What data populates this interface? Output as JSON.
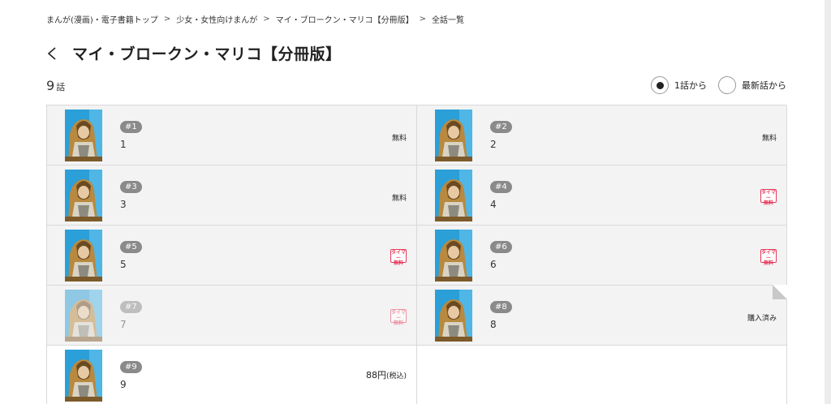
{
  "breadcrumb": [
    "まんが(漫画)・電子書籍トップ",
    "少女・女性向けまんが",
    "マイ・ブロークン・マリコ【分冊版】",
    "全話一覧"
  ],
  "breadcrumb_sep": ">",
  "title": "マイ・ブロークン・マリコ【分冊版】",
  "episode_count": "9",
  "episode_count_unit": "話",
  "order_options": [
    "1話から",
    "最新話から"
  ],
  "episodes": [
    {
      "badge": "#1",
      "title": "1",
      "status": "無料"
    },
    {
      "badge": "#2",
      "title": "2",
      "status": "無料"
    },
    {
      "badge": "#3",
      "title": "3",
      "status": "無料"
    },
    {
      "badge": "#4",
      "title": "4",
      "stamp": "タイマー無料"
    },
    {
      "badge": "#5",
      "title": "5",
      "stamp": "タイマー無料"
    },
    {
      "badge": "#6",
      "title": "6",
      "stamp": "タイマー無料"
    },
    {
      "badge": "#7",
      "title": "7",
      "stamp": "タイマー無料"
    },
    {
      "badge": "#8",
      "title": "8",
      "status": "購入済み"
    },
    {
      "badge": "#9",
      "title": "9",
      "price": "88円",
      "price_note": "(税込)"
    }
  ],
  "stamp_lines": [
    "タイマー",
    "無料"
  ],
  "colors": {
    "stamp": "#e53a5b",
    "badge": "#8a8a8a",
    "row_bg": "#f3f3f3"
  }
}
